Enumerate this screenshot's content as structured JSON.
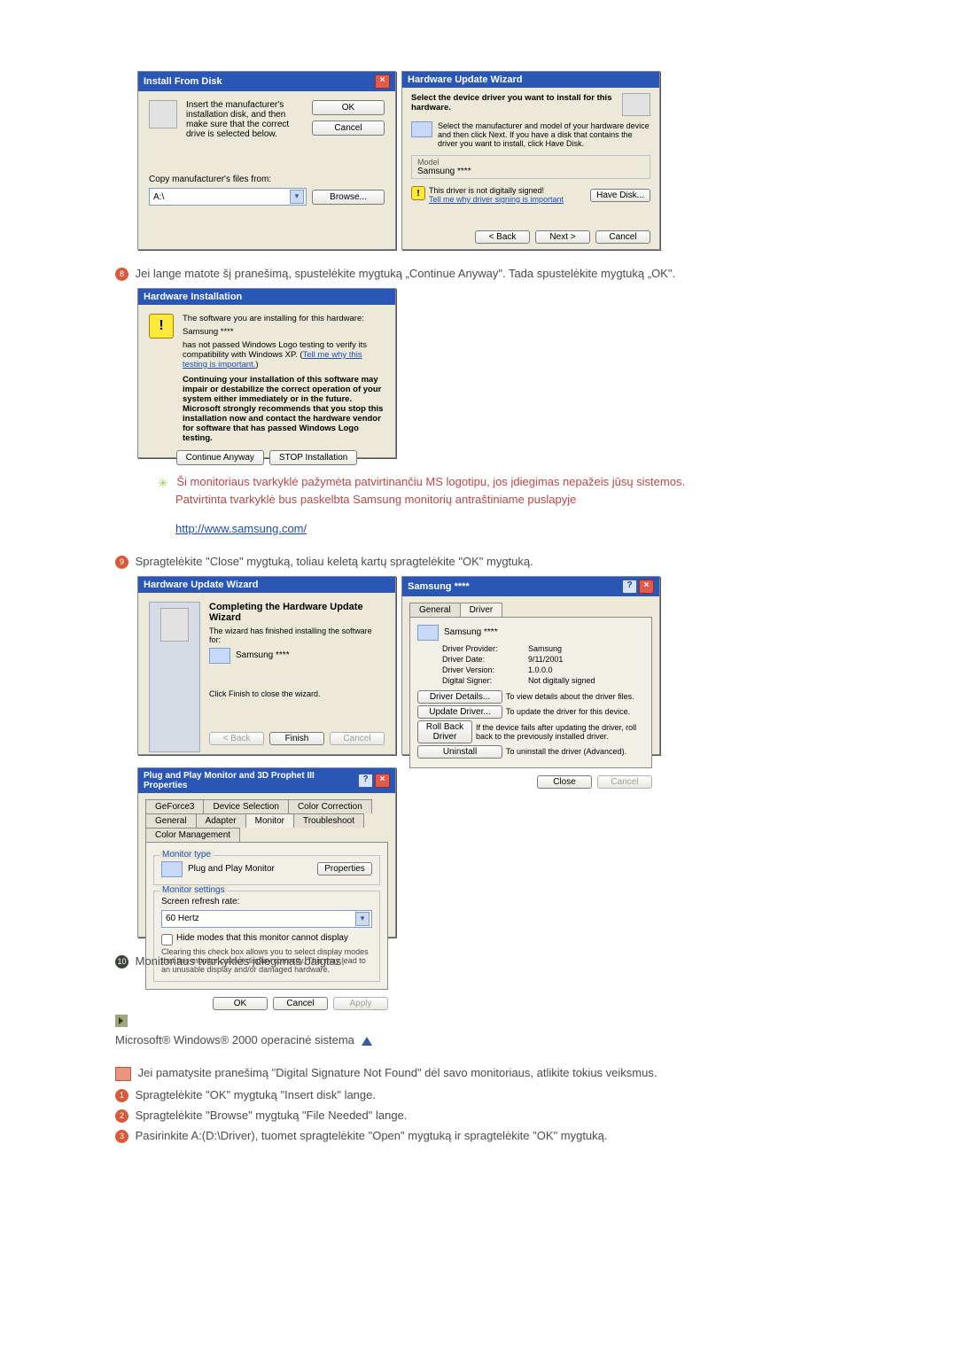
{
  "dialogs": {
    "install_from_disk": {
      "title": "Install From Disk",
      "instruction": "Insert the manufacturer's installation disk, and then make sure that the correct drive is selected below.",
      "copy_from_label": "Copy manufacturer's files from:",
      "drive_value": "A:\\",
      "buttons": {
        "ok": "OK",
        "cancel": "Cancel",
        "browse": "Browse..."
      }
    },
    "hw_update_select": {
      "title": "Hardware Update Wizard",
      "heading": "Select the device driver you want to install for this hardware.",
      "subtext": "Select the manufacturer and model of your hardware device and then click Next. If you have a disk that contains the driver you want to install, click Have Disk.",
      "model_label": "Model",
      "model_value": "Samsung ****",
      "warn_text": "This driver is not digitally signed!",
      "warn_link": "Tell me why driver signing is important",
      "buttons": {
        "have_disk": "Have Disk...",
        "back": "< Back",
        "next": "Next >",
        "cancel": "Cancel"
      }
    },
    "hw_install_warn": {
      "title": "Hardware Installation",
      "line1": "The software you are installing for this hardware:",
      "device": "Samsung ****",
      "line2": "has not passed Windows Logo testing to verify its compatibility with Windows XP. (",
      "line2_link": "Tell me why this testing is important.",
      "line2_end": ")",
      "bold_block": "Continuing your installation of this software may impair or destabilize the correct operation of your system either immediately or in the future. Microsoft strongly recommends that you stop this installation now and contact the hardware vendor for software that has passed Windows Logo testing.",
      "buttons": {
        "continue": "Continue Anyway",
        "stop": "STOP Installation"
      }
    },
    "hw_update_finish": {
      "title": "Hardware Update Wizard",
      "heading": "Completing the Hardware Update Wizard",
      "line1": "The wizard has finished installing the software for:",
      "device": "Samsung ****",
      "line2": "Click Finish to close the wizard.",
      "buttons": {
        "back": "< Back",
        "finish": "Finish",
        "cancel": "Cancel"
      }
    },
    "driver_tab": {
      "title": "Samsung ****",
      "tabs": {
        "general": "General",
        "driver": "Driver"
      },
      "device": "Samsung ****",
      "provider_label": "Driver Provider:",
      "provider_value": "Samsung",
      "date_label": "Driver Date:",
      "date_value": "9/11/2001",
      "version_label": "Driver Version:",
      "version_value": "1.0.0.0",
      "signer_label": "Digital Signer:",
      "signer_value": "Not digitally signed",
      "actions": {
        "details": {
          "btn": "Driver Details...",
          "desc": "To view details about the driver files."
        },
        "update": {
          "btn": "Update Driver...",
          "desc": "To update the driver for this device."
        },
        "rollback": {
          "btn": "Roll Back Driver",
          "desc": "If the device fails after updating the driver, roll back to the previously installed driver."
        },
        "uninstall": {
          "btn": "Uninstall",
          "desc": "To uninstall the driver (Advanced)."
        }
      },
      "buttons": {
        "close": "Close",
        "cancel": "Cancel"
      }
    },
    "pnp": {
      "title": "Plug and Play Monitor and 3D Prophet III Properties",
      "tabs": {
        "geforce": "GeForce3",
        "device_selection": "Device Selection",
        "color_correction": "Color Correction",
        "general": "General",
        "adapter": "Adapter",
        "monitor": "Monitor",
        "troubleshoot": "Troubleshoot",
        "color_management": "Color Management"
      },
      "group_type": "Monitor type",
      "monitor_name": "Plug and Play Monitor",
      "properties_btn": "Properties",
      "group_settings": "Monitor settings",
      "refresh_label": "Screen refresh rate:",
      "refresh_value": "60 Hertz",
      "hide_checkbox": "Hide modes that this monitor cannot display",
      "hide_desc": "Clearing this check box allows you to select display modes that this monitor cannot display correctly. This may lead to an unusable display and/or damaged hardware.",
      "buttons": {
        "ok": "OK",
        "cancel": "Cancel",
        "apply": "Apply"
      }
    }
  },
  "body": {
    "step8": "Jei lange matote šį pranešimą, spustelėkite mygtuką „Continue Anyway\". Tada spustelėkite mygtuką „OK\".",
    "note_red": "Ši monitoriaus tvarkyklė pažymėta patvirtinančiu MS logotipu, jos įdiegimas nepažeis jūsų sistemos.",
    "note_line2": "Patvirtinta tvarkyklė bus paskelbta Samsung monitorių antraštiniame puslapyje",
    "url": "http://www.samsung.com/",
    "step9": "Spragtelėkite \"Close\" mygtuką, toliau keletą kartų spragtelėkite \"OK\" mygtuką.",
    "step10": "Monitoriaus tvarkyklės įdiegimas baigtas.",
    "os_heading": "Microsoft® Windows® 2000 operacinė sistema",
    "win2000_intro": "Jei pamatysite pranešimą \"Digital Signature Not Found\" dėl savo monitoriaus, atlikite tokius veiksmus.",
    "win2000_1": "Spragtelėkite \"OK\" mygtuką \"Insert disk\" lange.",
    "win2000_2": "Spragtelėkite \"Browse\" mygtuką \"File Needed\" lange.",
    "win2000_3": "Pasirinkite A:(D:\\Driver), tuomet spragtelėkite \"Open\" mygtuką ir spragtelėkite \"OK\" mygtuką."
  }
}
